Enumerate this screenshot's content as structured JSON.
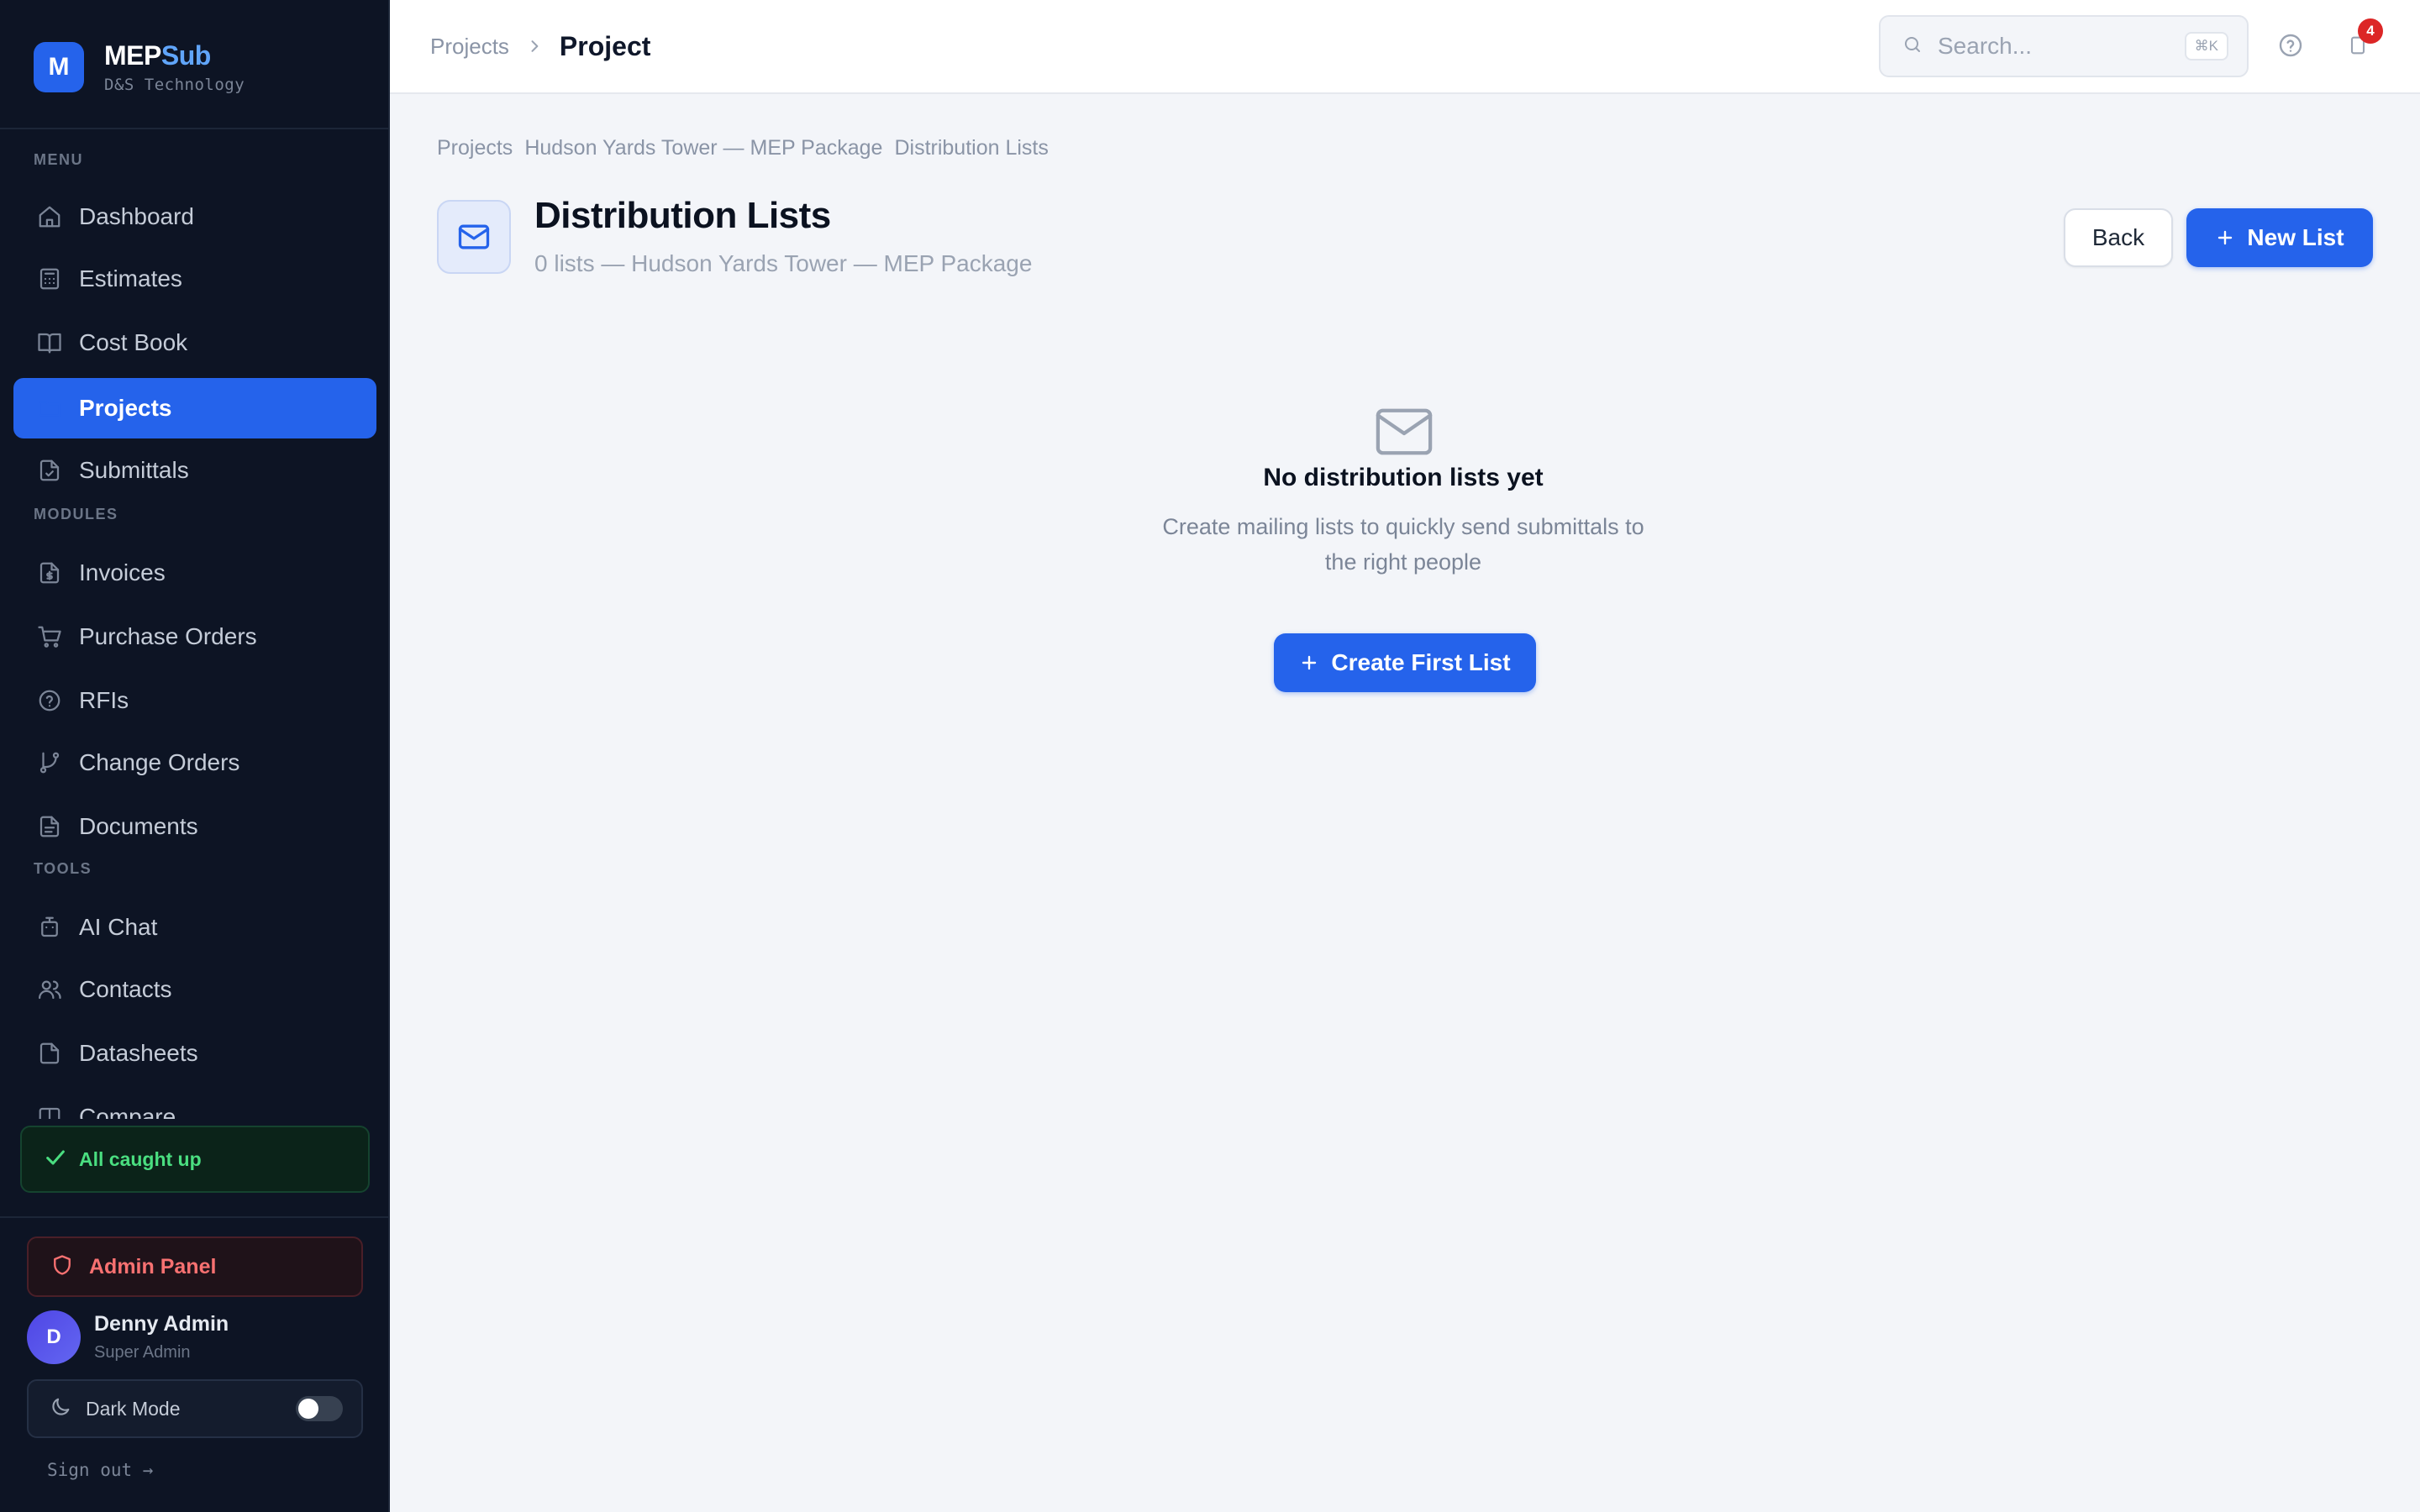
{
  "brand": {
    "logo_letter": "M",
    "name_part1": "MEP",
    "name_part2": "Sub",
    "subtitle": "D&S Technology"
  },
  "sidebar": {
    "sections": {
      "menu": "MENU",
      "modules": "MODULES",
      "tools": "TOOLS"
    },
    "items": [
      {
        "label": "Dashboard",
        "icon": "home-icon",
        "active": false
      },
      {
        "label": "Estimates",
        "icon": "calculator-icon",
        "active": false
      },
      {
        "label": "Cost Book",
        "icon": "book-icon",
        "active": false
      },
      {
        "label": "Projects",
        "icon": "folder-icon",
        "active": true
      },
      {
        "label": "Submittals",
        "icon": "file-check-icon",
        "active": false
      },
      {
        "label": "Invoices",
        "icon": "invoice-icon",
        "active": false
      },
      {
        "label": "Purchase Orders",
        "icon": "cart-icon",
        "active": false
      },
      {
        "label": "RFIs",
        "icon": "help-circle-icon",
        "active": false
      },
      {
        "label": "Change Orders",
        "icon": "git-branch-icon",
        "active": false
      },
      {
        "label": "Documents",
        "icon": "document-icon",
        "active": false
      },
      {
        "label": "AI Chat",
        "icon": "bot-icon",
        "active": false
      },
      {
        "label": "Contacts",
        "icon": "users-icon",
        "active": false
      },
      {
        "label": "Datasheets",
        "icon": "file-icon",
        "active": false
      },
      {
        "label": "Compare",
        "icon": "columns-icon",
        "active": false
      }
    ],
    "status": "All caught up",
    "admin_panel": "Admin Panel",
    "user": {
      "initial": "D",
      "name": "Denny Admin",
      "role": "Super Admin"
    },
    "dark_mode_label": "Dark Mode",
    "dark_mode_on": false,
    "sign_out": "Sign out →"
  },
  "topbar": {
    "breadcrumb_parent": "Projects",
    "breadcrumb_current": "Project",
    "search_placeholder": "Search...",
    "search_shortcut": "⌘K",
    "notification_count": "4"
  },
  "main": {
    "breadcrumb": [
      "Projects",
      "Hudson Yards Tower — MEP Package",
      "Distribution Lists"
    ],
    "title": "Distribution Lists",
    "subtitle": "0 lists — Hudson Yards Tower — MEP Package",
    "back_label": "Back",
    "new_list_label": "New List",
    "empty": {
      "title": "No distribution lists yet",
      "description": "Create mailing lists to quickly send submittals to the right people",
      "button_label": "Create First List"
    }
  },
  "colors": {
    "accent": "#2563eb",
    "sidebar_bg": "#0d1424",
    "success": "#4ade80",
    "danger": "#f87171"
  }
}
